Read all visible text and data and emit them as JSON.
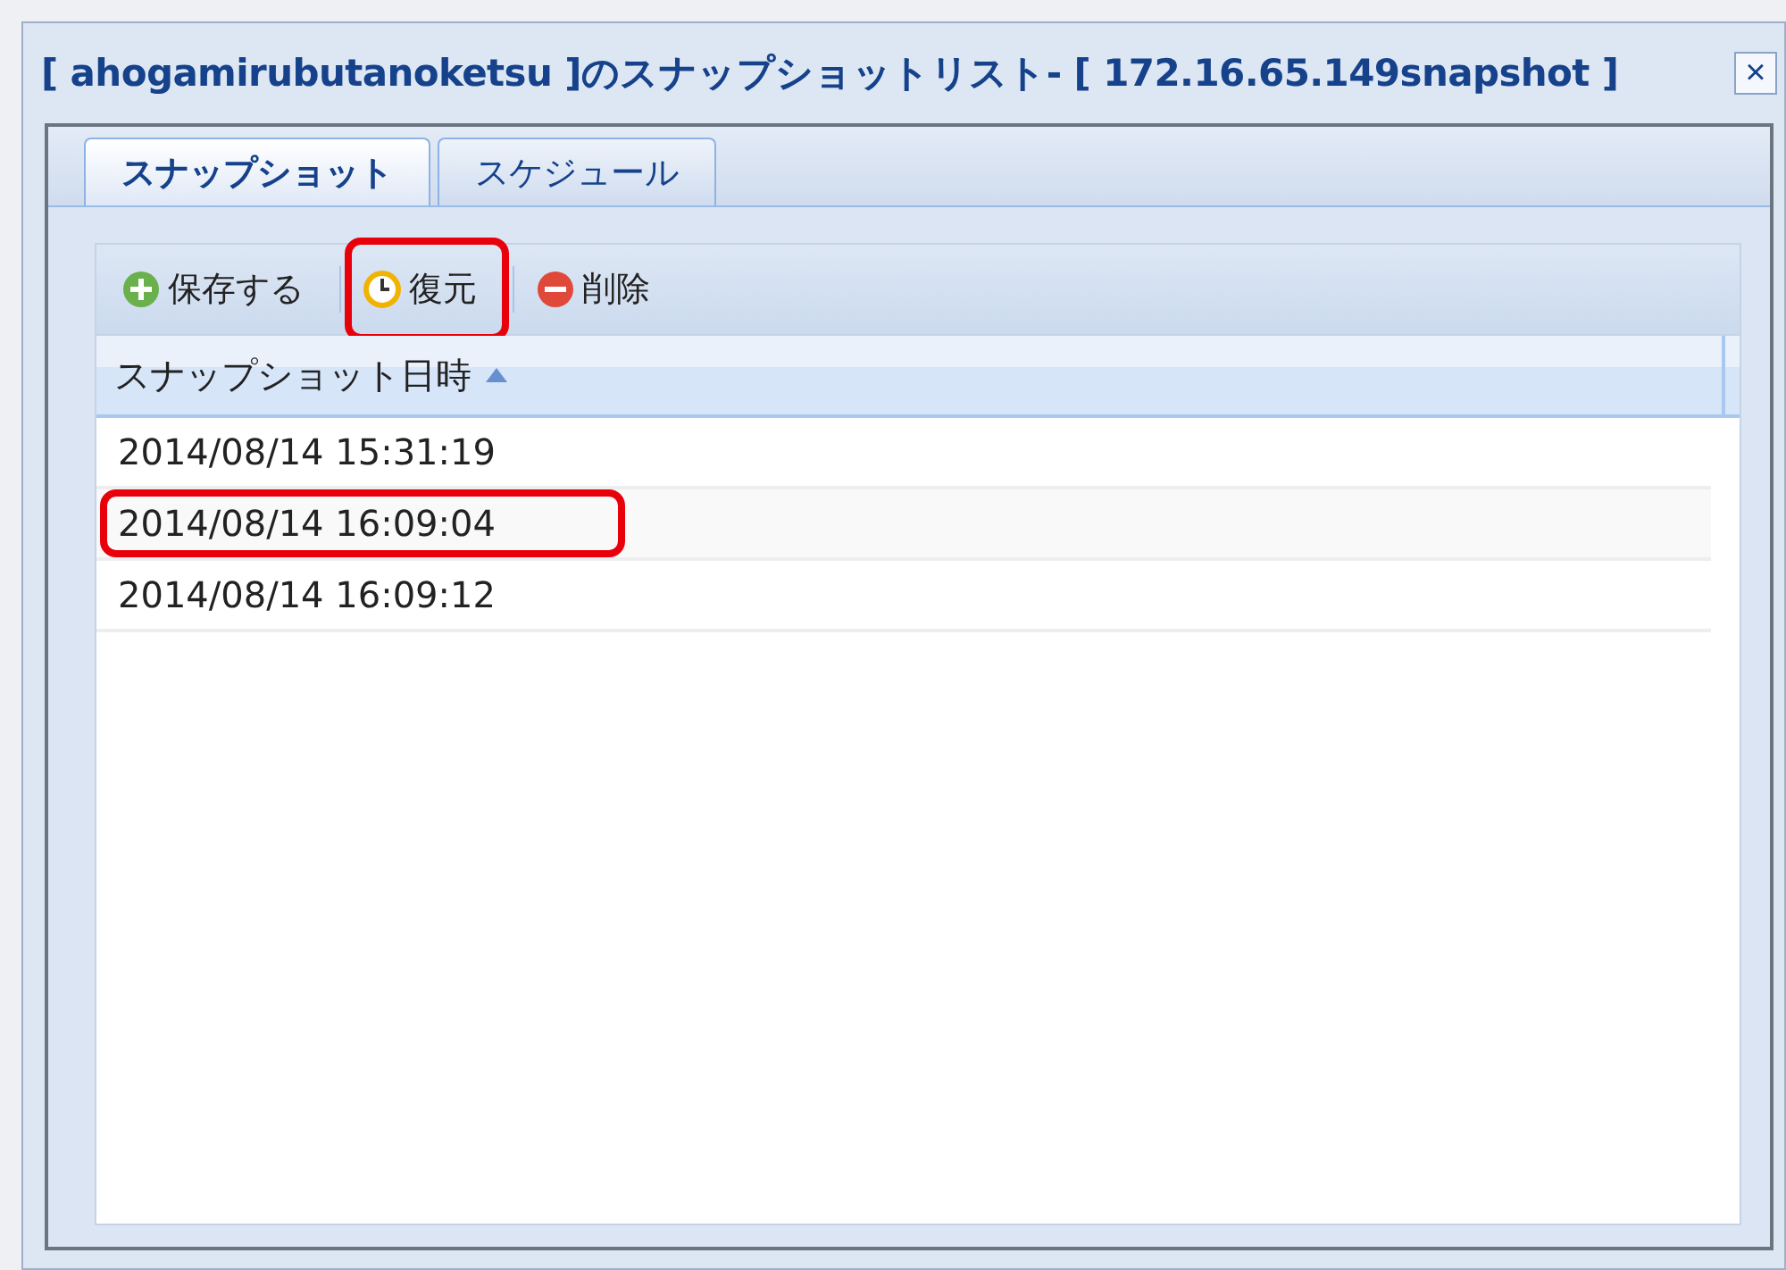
{
  "window": {
    "title": "[ ahogamirubutanoketsu ]のスナップショットリスト- [ 172.16.65.149snapshot ]",
    "close": "×"
  },
  "tabs": [
    {
      "label": "スナップショット",
      "selected": true
    },
    {
      "label": "スケジュール",
      "selected": false
    }
  ],
  "toolbar": [
    {
      "label": "保存する",
      "kind": "add",
      "highlighted": false
    },
    {
      "label": "復元",
      "kind": "restore",
      "highlighted": true
    },
    {
      "label": "削除",
      "kind": "delete",
      "highlighted": false
    }
  ],
  "table": {
    "columns": [
      {
        "label": "スナップショット日時",
        "sort_ascending": true
      }
    ],
    "rows": [
      {
        "cells": [
          "2014/08/14 15:31:19"
        ],
        "highlighted": false
      },
      {
        "cells": [
          "2014/08/14 16:09:04"
        ],
        "highlighted": true
      },
      {
        "cells": [
          "2014/08/14 16:09:12"
        ],
        "highlighted": false
      }
    ]
  }
}
